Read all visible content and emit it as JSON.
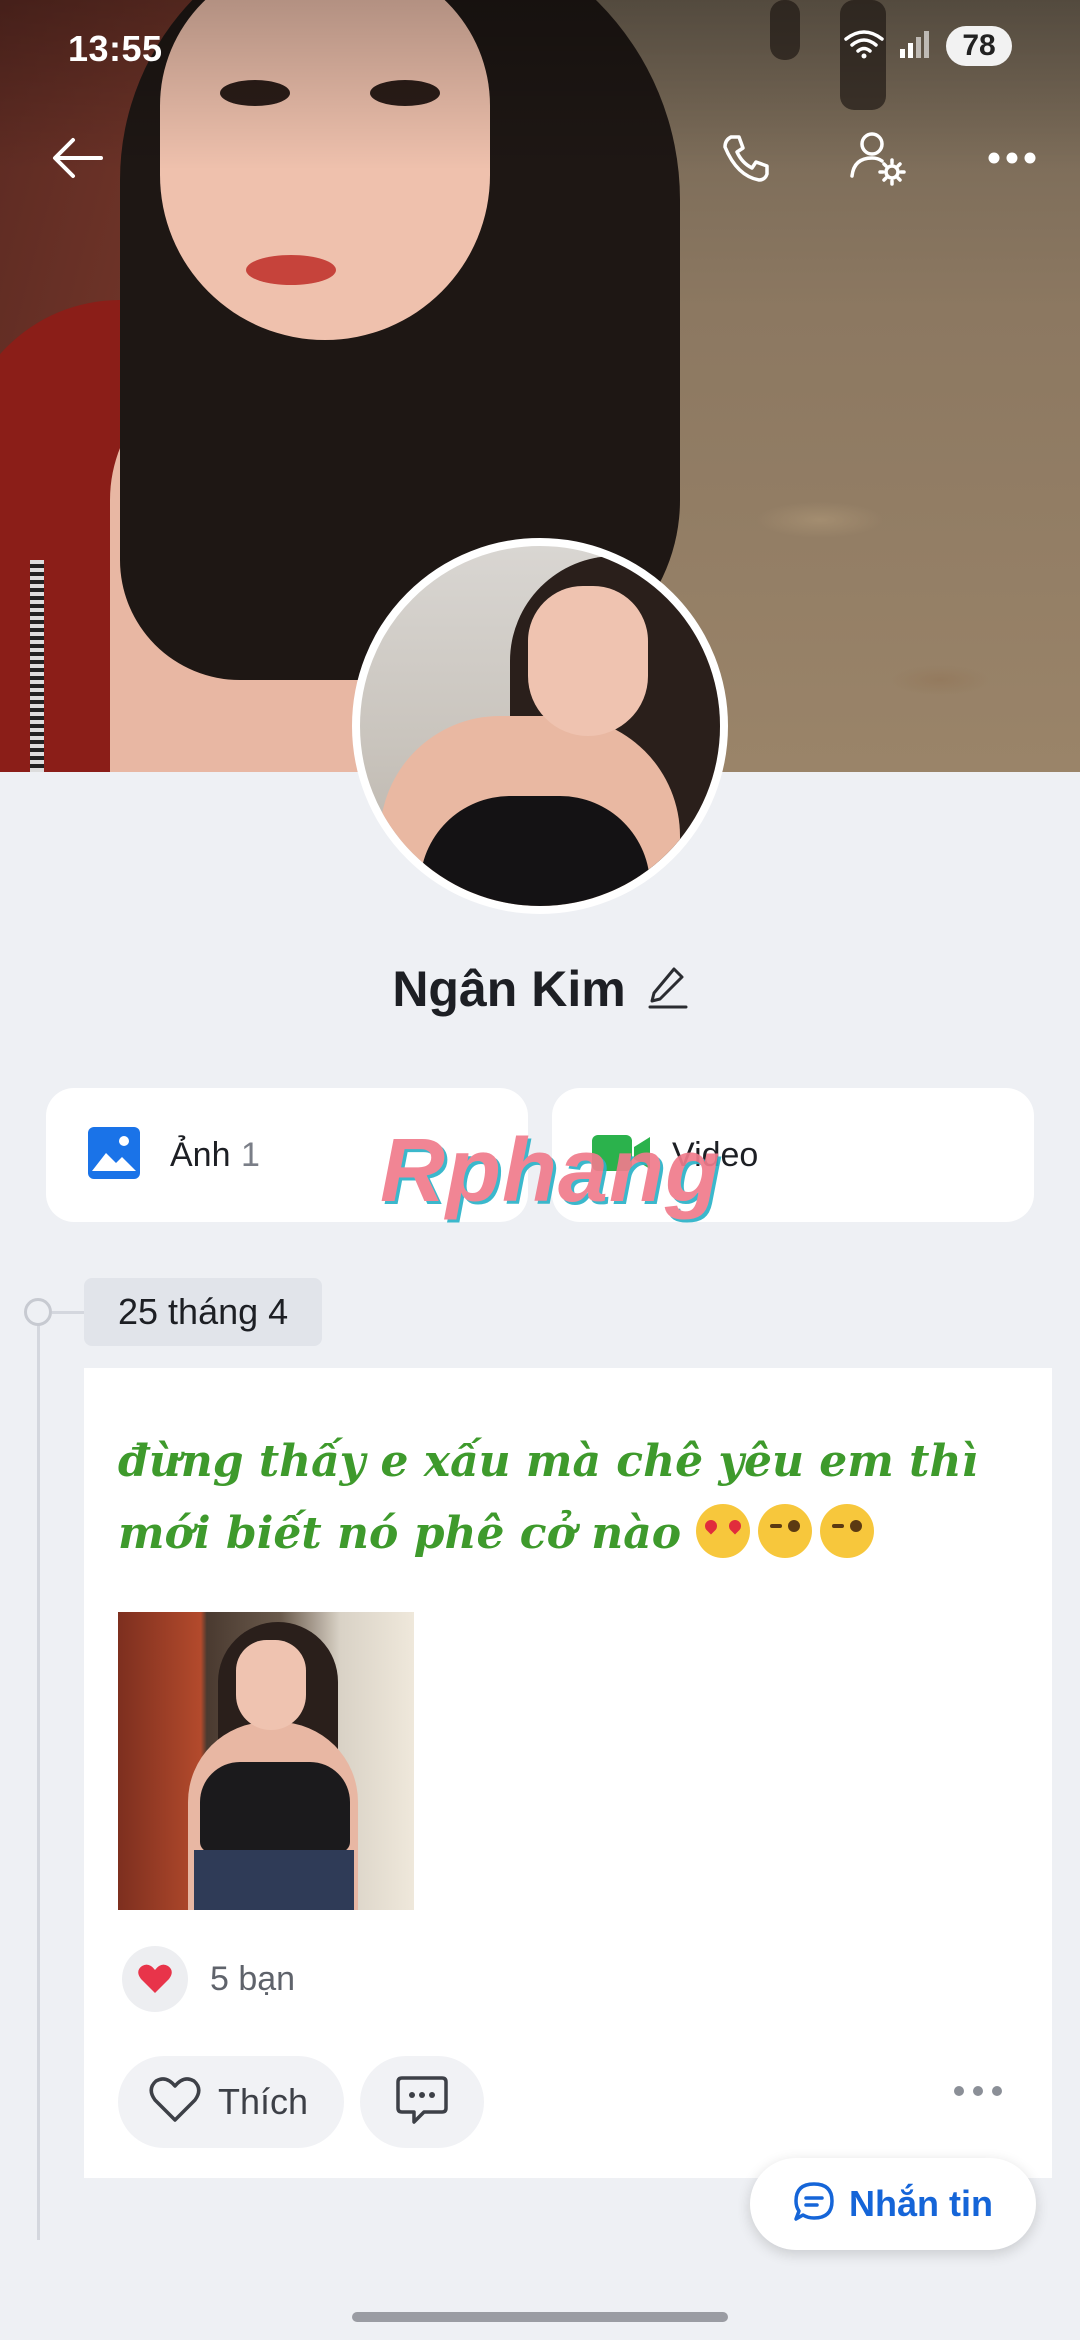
{
  "status_bar": {
    "time": "13:55",
    "battery": "78",
    "icons": [
      "wifi-icon",
      "signal-icon"
    ]
  },
  "top_nav": {
    "icons": [
      "back-arrow-icon",
      "phone-call-icon",
      "user-settings-icon",
      "more-options-icon"
    ]
  },
  "profile": {
    "name": "Ngân Kim",
    "edit_icon": "pencil-icon"
  },
  "media": {
    "photos_label": "Ảnh",
    "photos_count": "1",
    "videos_label": "Video"
  },
  "watermark": "Rphang",
  "timeline": {
    "date": "25 tháng 4",
    "post": {
      "text": "đừng thấy e xấu mà chê yêu em thì mới biết nó phê cở nào",
      "emojis": [
        "heart-eyes-emoji",
        "wink-tongue-emoji",
        "wink-tongue-emoji"
      ],
      "reaction_count": "5 bạn",
      "like_label": "Thích"
    }
  },
  "fab": {
    "label": "Nhắn tin"
  },
  "colors": {
    "accent": "#1565d8",
    "post_text": "#3e9a2c",
    "background": "#eef0f4",
    "heart": "#e8344a"
  }
}
